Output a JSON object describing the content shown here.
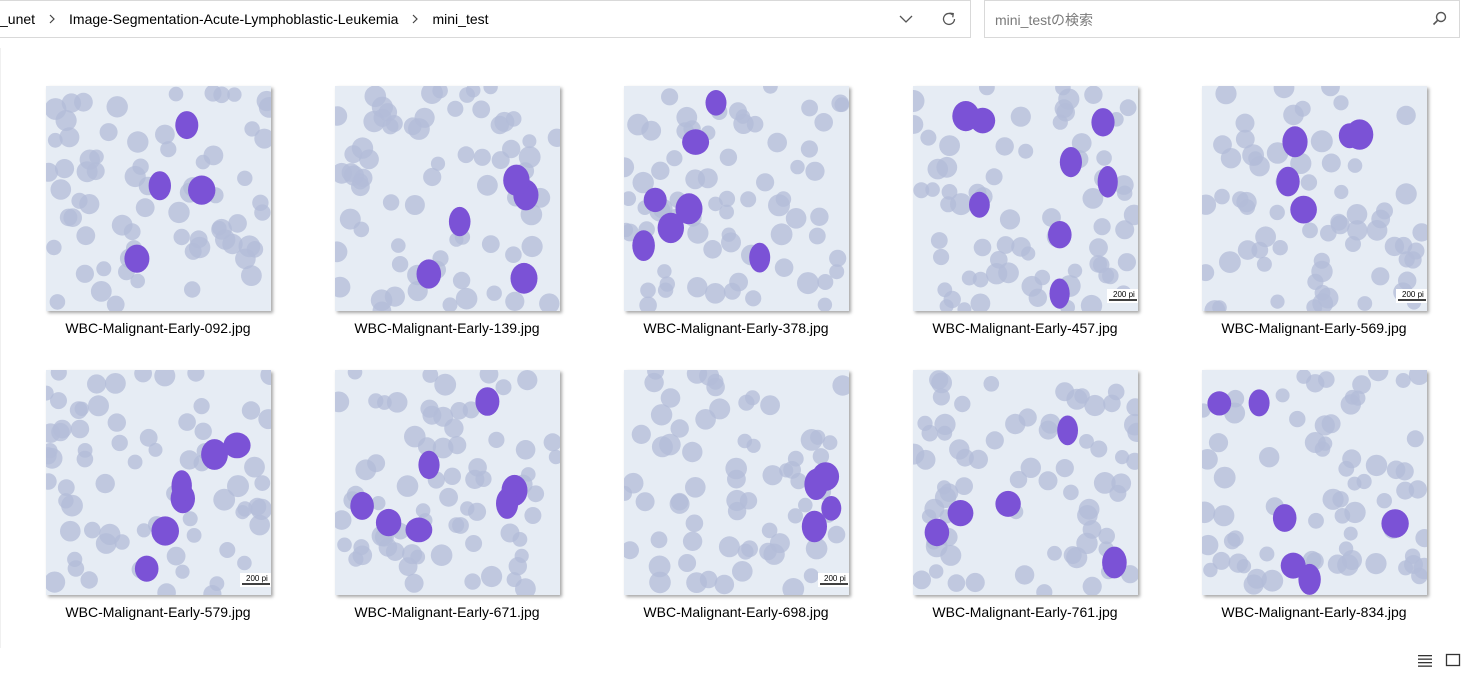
{
  "address": {
    "crumbs": [
      "_unet",
      "Image-Segmentation-Acute-Lymphoblastic-Leukemia",
      "mini_test"
    ]
  },
  "search": {
    "placeholder": "mini_testの検索"
  },
  "files": [
    {
      "name": "WBC-Malignant-Early-092.jpg",
      "scale_label": ""
    },
    {
      "name": "WBC-Malignant-Early-139.jpg",
      "scale_label": ""
    },
    {
      "name": "WBC-Malignant-Early-378.jpg",
      "scale_label": ""
    },
    {
      "name": "WBC-Malignant-Early-457.jpg",
      "scale_label": "200 pi"
    },
    {
      "name": "WBC-Malignant-Early-569.jpg",
      "scale_label": "200 pi"
    },
    {
      "name": "WBC-Malignant-Early-579.jpg",
      "scale_label": "200 pi"
    },
    {
      "name": "WBC-Malignant-Early-671.jpg",
      "scale_label": ""
    },
    {
      "name": "WBC-Malignant-Early-698.jpg",
      "scale_label": "200 pi"
    },
    {
      "name": "WBC-Malignant-Early-761.jpg",
      "scale_label": ""
    },
    {
      "name": "WBC-Malignant-Early-834.jpg",
      "scale_label": ""
    }
  ],
  "icons": {
    "chevron": "chevron-down-icon",
    "refresh": "refresh-icon",
    "search": "search-icon",
    "details_view": "details-view-icon",
    "large_icons_view": "large-icons-view-icon"
  },
  "colors": {
    "thumb_bg": "#e6ecf4",
    "rbc": "#b3bcd8",
    "blast": "#7b52d6"
  }
}
